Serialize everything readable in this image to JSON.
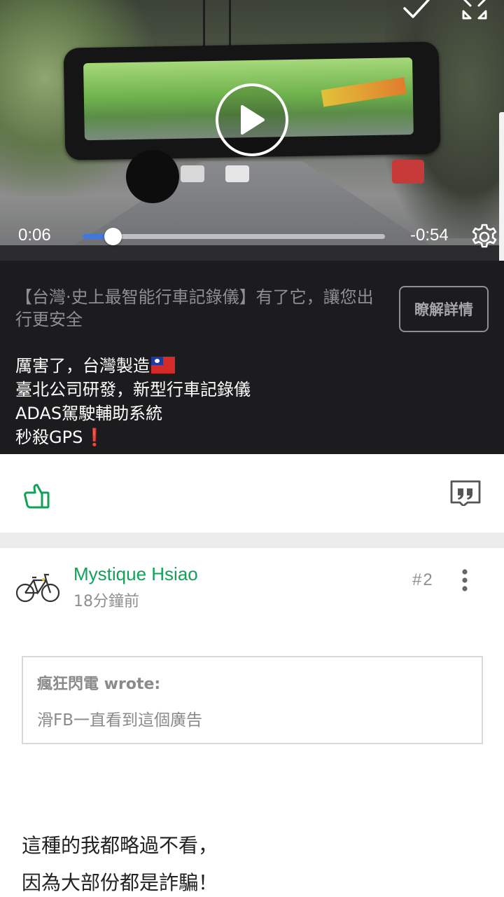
{
  "video": {
    "current_time": "0:06",
    "remaining_time": "-0:54",
    "progress_fraction": 0.1,
    "icons": [
      "check-icon",
      "expand-icon",
      "play-icon",
      "settings-icon"
    ]
  },
  "ad": {
    "headline": "【台灣·史上最智能行車記錄儀】有了它，讓您出行更安全",
    "learn_more_label": "瞭解詳情",
    "body_line1": "厲害了，台灣製造",
    "body_line2": "臺北公司研發，新型行車記錄儀",
    "body_line3": "ADAS駕駛輔助系統",
    "body_line4": "秒殺GPS"
  },
  "actions": {
    "icons": [
      "thumbs-up-icon",
      "quote-icon"
    ]
  },
  "post": {
    "author": "Mystique Hsiao",
    "time_ago": "18分鐘前",
    "floor": "#2",
    "quote": {
      "author": "瘋狂閃電 wrote:",
      "text": "滑FB一直看到這個廣告"
    },
    "body_line1": "這種的我都略過不看，",
    "body_line2": "因為大部份都是詐騙！"
  },
  "colors": {
    "accent_green": "#14a05a",
    "progress_blue": "#3f78d8",
    "ad_background": "#1c1c1e",
    "divider_gray": "#ececec"
  }
}
